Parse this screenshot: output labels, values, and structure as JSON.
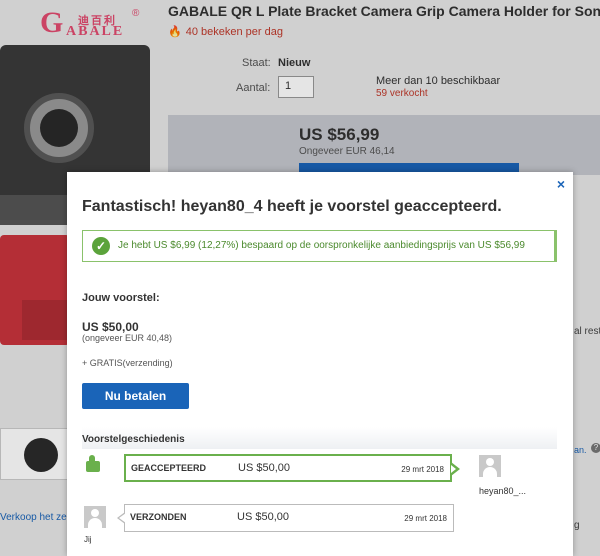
{
  "logo": {
    "letter": "G",
    "chinese": "迪百利",
    "rest": "ABALE",
    "reg": "®"
  },
  "listing": {
    "title": "GABALE QR L Plate Bracket Camera Grip Camera Holder for Sony",
    "views": "40 bekeken per dag",
    "condition_label": "Staat:",
    "condition_value": "Nieuw",
    "quantity_label": "Aantal:",
    "quantity_value": "1",
    "available": "Meer dan 10 beschikbaar",
    "sold": "59 verkocht",
    "price": "US $56,99",
    "approx": "Ongeveer EUR 46,14"
  },
  "background": {
    "sell_link": "Verkoop het zelf",
    "right_rest": "al rest",
    "right_an": "an.",
    "right_q": "?",
    "right_g": "g"
  },
  "modal": {
    "close": "×",
    "title": "Fantastisch! heyan80_4 heeft je voorstel geaccepteerd.",
    "success_text": "Je hebt US $6,99 (12,27%) bespaard op de oorspronkelijke aanbiedingsprijs van US $56,99",
    "your_offer_label": "Jouw voorstel:",
    "your_offer_price": "US $50,00",
    "your_offer_approx": "(ongeveer EUR 40,48)",
    "shipping": "+ GRATIS(verzending)",
    "pay_button": "Nu betalen",
    "history_title": "Voorstelgeschiedenis",
    "history": [
      {
        "status": "GEACCEPTEERD",
        "amount": "US $50,00",
        "date": "29 mrt 2018",
        "who": "heyan80_..."
      },
      {
        "status": "VERZONDEN",
        "amount": "US $50,00",
        "date": "29 mrt 2018",
        "who": "Jij"
      }
    ]
  },
  "colors": {
    "accent": "#1a64b8",
    "success": "#6ab04c",
    "alert": "#c0392b"
  }
}
